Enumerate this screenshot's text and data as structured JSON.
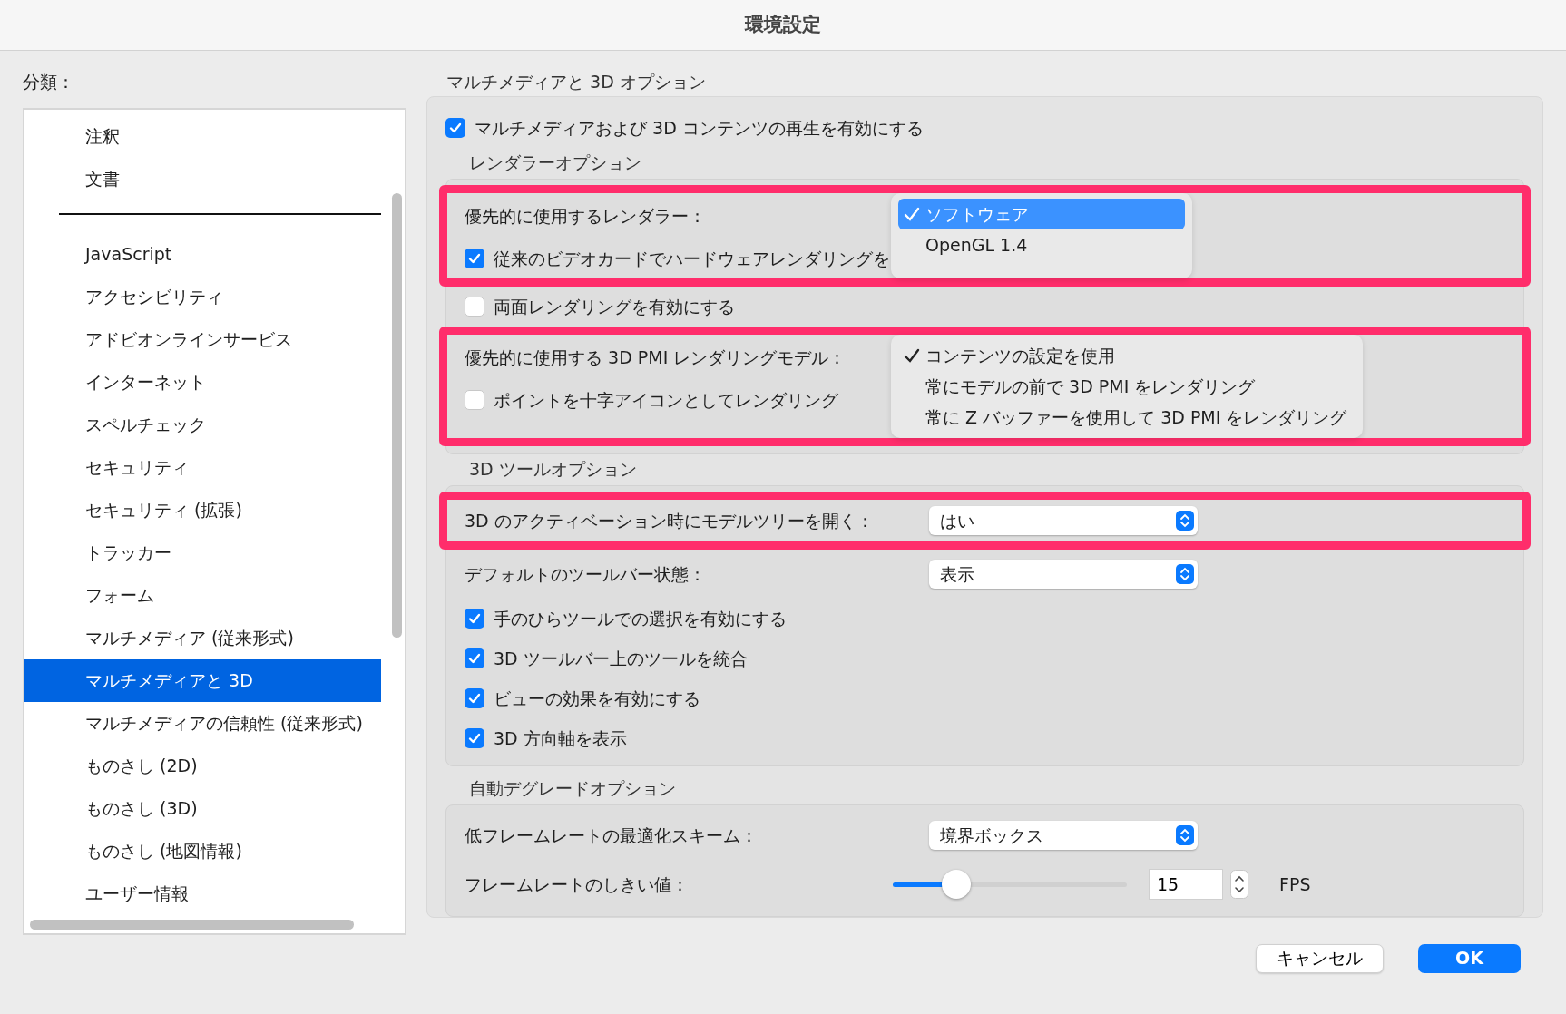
{
  "window": {
    "title": "環境設定"
  },
  "sidebar": {
    "label": "分類：",
    "items": [
      {
        "kind": "item",
        "label": "注釈",
        "selected": false
      },
      {
        "kind": "item",
        "label": "文書",
        "selected": false
      },
      {
        "kind": "separator"
      },
      {
        "kind": "item",
        "label": "JavaScript",
        "selected": false
      },
      {
        "kind": "item",
        "label": "アクセシビリティ",
        "selected": false
      },
      {
        "kind": "item",
        "label": "アドビオンラインサービス",
        "selected": false
      },
      {
        "kind": "item",
        "label": "インターネット",
        "selected": false
      },
      {
        "kind": "item",
        "label": "スペルチェック",
        "selected": false
      },
      {
        "kind": "item",
        "label": "セキュリティ",
        "selected": false
      },
      {
        "kind": "item",
        "label": "セキュリティ (拡張)",
        "selected": false
      },
      {
        "kind": "item",
        "label": "トラッカー",
        "selected": false
      },
      {
        "kind": "item",
        "label": "フォーム",
        "selected": false
      },
      {
        "kind": "item",
        "label": "マルチメディア (従来形式)",
        "selected": false
      },
      {
        "kind": "item",
        "label": "マルチメディアと 3D",
        "selected": true
      },
      {
        "kind": "item",
        "label": "マルチメディアの信頼性 (従来形式)",
        "selected": false
      },
      {
        "kind": "item",
        "label": "ものさし (2D)",
        "selected": false
      },
      {
        "kind": "item",
        "label": "ものさし (3D)",
        "selected": false
      },
      {
        "kind": "item",
        "label": "ものさし (地図情報)",
        "selected": false
      },
      {
        "kind": "item",
        "label": "ユーザー情報",
        "selected": false
      }
    ]
  },
  "panel": {
    "title": "マルチメディアと 3D オプション",
    "enable": {
      "label": "マルチメディアおよび 3D コンテンツの再生を有効にする",
      "checked": true
    },
    "renderer": {
      "heading": "レンダラーオプション",
      "preferred": {
        "label": "優先的に使用するレンダラー：",
        "highlighted": true,
        "menu": [
          {
            "label": "ソフトウェア",
            "selected": true
          },
          {
            "label": "OpenGL 1.4",
            "selected": false
          }
        ]
      },
      "legacy": {
        "label": "従来のビデオカードでハードウェアレンダリングを",
        "checked": true
      },
      "double_sided": {
        "label": "両面レンダリングを有効にする",
        "checked": false
      },
      "pmi": {
        "label": "優先的に使用する 3D PMI レンダリングモデル：",
        "highlighted": true,
        "menu": [
          {
            "label": "コンテンツの設定を使用",
            "selected": true
          },
          {
            "label": "常にモデルの前で 3D PMI をレンダリング",
            "selected": false
          },
          {
            "label": "常に Z バッファーを使用して 3D PMI をレンダリング",
            "selected": false
          }
        ]
      },
      "points": {
        "label": "ポイントを十字アイコンとしてレンダリング",
        "checked": false
      }
    },
    "tools": {
      "heading": "3D ツールオプション",
      "selects": [
        {
          "label": "3D のアクティベーション時にモデルツリーを開く：",
          "value": "はい",
          "highlighted": true
        },
        {
          "label": "デフォルトのツールバー状態：",
          "value": "表示",
          "highlighted": false
        }
      ],
      "checkboxes": [
        {
          "label": "手のひらツールでの選択を有効にする",
          "checked": true
        },
        {
          "label": "3D ツールバー上のツールを統合",
          "checked": true
        },
        {
          "label": "ビューの効果を有効にする",
          "checked": true
        },
        {
          "label": "3D 方向軸を表示",
          "checked": true
        }
      ]
    },
    "degrade": {
      "heading": "自動デグレードオプション",
      "scheme": {
        "label": "低フレームレートの最適化スキーム：",
        "value": "境界ボックス"
      },
      "threshold": {
        "label": "フレームレートのしきい値：",
        "level": 0.27,
        "value": "15",
        "unit": "FPS"
      }
    }
  },
  "buttons": [
    {
      "label": "キャンセル",
      "kind": "secondary"
    },
    {
      "label": "OK",
      "kind": "primary"
    }
  ]
}
